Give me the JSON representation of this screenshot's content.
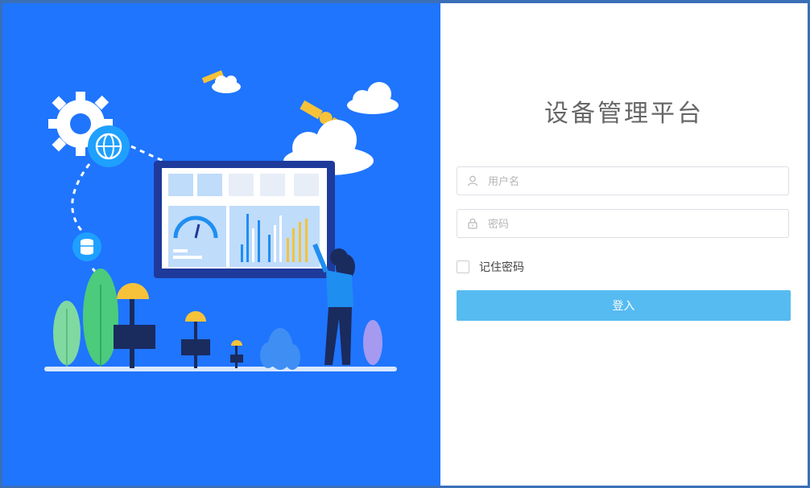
{
  "login": {
    "title": "设备管理平台",
    "username_placeholder": "用户名",
    "password_placeholder": "密码",
    "remember_label": "记住密码",
    "submit_label": "登入"
  },
  "colors": {
    "left_panel_bg": "#1f75fe",
    "button_bg": "#56bbf1",
    "title_text": "#666666"
  },
  "icons": [
    "gear-icon",
    "globe-icon",
    "database-icon",
    "satellite-icon",
    "cloud-icon",
    "user-icon",
    "lock-icon"
  ]
}
